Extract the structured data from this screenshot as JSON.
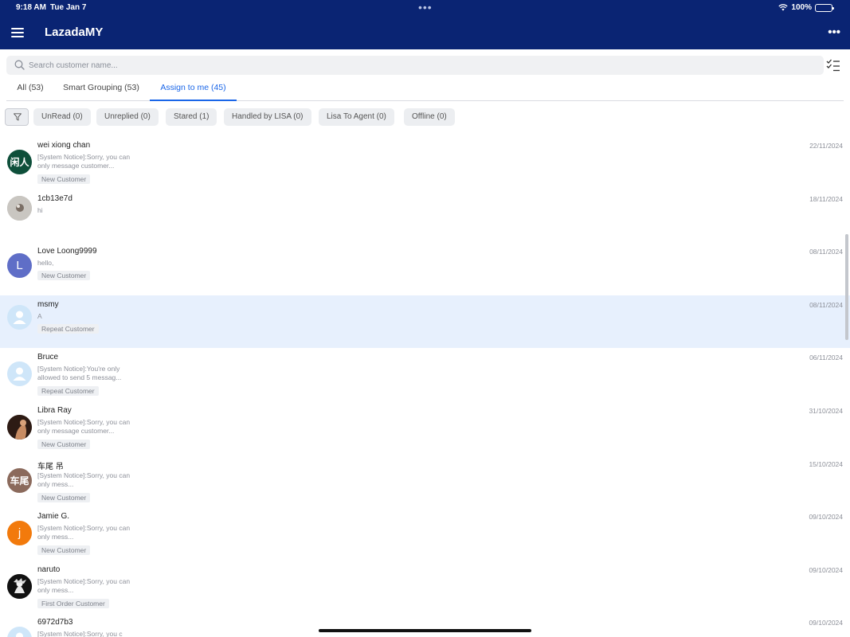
{
  "status_bar": {
    "time": "9:18 AM",
    "date": "Tue Jan 7",
    "battery": "100%"
  },
  "header": {
    "title": "LazadaMY"
  },
  "search": {
    "placeholder": "Search customer name..."
  },
  "tabs": [
    {
      "label": "All (53)"
    },
    {
      "label": "Smart Grouping (53)"
    },
    {
      "label": "Assign to me (45)",
      "active": true
    }
  ],
  "filters": [
    {
      "label": "UnRead (0)"
    },
    {
      "label": "Unreplied (0)"
    },
    {
      "label": "Stared (1)"
    },
    {
      "label": "Handled by LISA (0)"
    },
    {
      "label": "Lisa To Agent (0)"
    },
    {
      "label": "Offline (0)"
    }
  ],
  "conversations": [
    {
      "name": "wei xiong chan",
      "preview": "[System Notice]:Sorry, you can only message customer...",
      "tag": "New Customer",
      "date": "22/11/2024",
      "avatar_text": "闲人",
      "avatar_color": "#0e4f3a"
    },
    {
      "name": "1cb13e7d",
      "preview": "hi",
      "tag": "",
      "date": "18/11/2024",
      "avatar_text": "",
      "avatar_color": "#b7b4b0"
    },
    {
      "name": "Love Loong9999",
      "preview": "hello,",
      "tag": "New Customer",
      "date": "08/11/2024",
      "avatar_text": "L",
      "avatar_color": "#5f6ec7"
    },
    {
      "name": "msmy",
      "preview": "A",
      "tag": "Repeat Customer",
      "date": "08/11/2024",
      "avatar_text": "",
      "avatar_color": "#cfe6f9",
      "selected": true
    },
    {
      "name": "Bruce",
      "preview": "[System Notice]:You're only allowed to send 5 messag...",
      "tag": "Repeat Customer",
      "date": "06/11/2024",
      "avatar_text": "",
      "avatar_color": "#cfe6f9"
    },
    {
      "name": "Libra Ray",
      "preview": "[System Notice]:Sorry, you can only message customer...",
      "tag": "New Customer",
      "date": "31/10/2024",
      "avatar_text": "",
      "avatar_color": "#4a2d22"
    },
    {
      "name": "车尾 吊",
      "preview": "[System Notice]:Sorry, you can only mess...",
      "tag": "New Customer",
      "date": "15/10/2024",
      "avatar_text": "车尾",
      "avatar_color": "#8b6a5c"
    },
    {
      "name": "Jamie G.",
      "preview": "[System Notice]:Sorry, you can only mess...",
      "tag": "New Customer",
      "date": "09/10/2024",
      "avatar_text": "j",
      "avatar_color": "#f27a0c"
    },
    {
      "name": "naruto",
      "preview": "[System Notice]:Sorry, you can only mess...",
      "tag": "First Order Customer",
      "date": "09/10/2024",
      "avatar_text": "",
      "avatar_color": "#1a1a1a"
    },
    {
      "name": "6972d7b3",
      "preview": "[System Notice]:Sorry, you c",
      "tag": "",
      "date": "09/10/2024",
      "avatar_text": "",
      "avatar_color": "#cfe6f9"
    }
  ]
}
